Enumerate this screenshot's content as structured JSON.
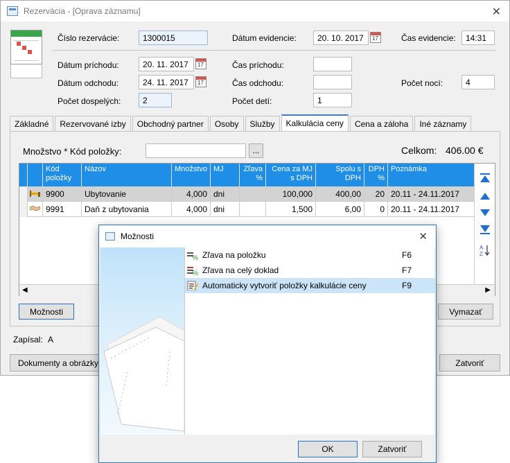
{
  "window": {
    "title": "Rezervácia - [Oprava záznamu]"
  },
  "header": {
    "cislo_label": "Číslo rezervácie:",
    "cislo_value": "1300015",
    "datum_ev_label": "Dátum evidencie:",
    "datum_ev_value": "20. 10. 2017",
    "cas_ev_label": "Čas evidencie:",
    "cas_ev_value": "14:31",
    "prichod_label": "Dátum príchodu:",
    "prichod_value": "20. 11. 2017",
    "cas_prichodu_label": "Čas príchodu:",
    "cas_prichodu_value": "",
    "odchod_label": "Dátum odchodu:",
    "odchod_value": "24. 11. 2017",
    "cas_odchodu_label": "Čas odchodu:",
    "cas_odchodu_value": "",
    "noci_label": "Počet nocí:",
    "noci_value": "4",
    "dospeli_label": "Počet dospelých:",
    "dospeli_value": "2",
    "deti_label": "Počet detí:",
    "deti_value": "1",
    "cal_glyph": "17"
  },
  "tabs": [
    "Základné",
    "Rezervované izby",
    "Obchodný partner",
    "Osoby",
    "Služby",
    "Kalkulácia ceny",
    "Cena a záloha",
    "Iné záznamy"
  ],
  "active_tab": "Kalkulácia ceny",
  "calc": {
    "qty_label": "Množstvo * Kód položky:",
    "qty_value": "",
    "browse_label": "...",
    "total_label": "Celkom:",
    "total_value": "406.00 €"
  },
  "table": {
    "headers": [
      "Kód položky",
      "Názov",
      "Množstvo",
      "MJ",
      "Zľava %",
      "Cena za MJ s DPH",
      "Spolu s DPH",
      "DPH %",
      "Poznámka"
    ],
    "rows": [
      {
        "icon": "bed-icon",
        "kod": "9900",
        "nazov": "Ubytovanie",
        "mnozstvo": "4,000",
        "mj": "dni",
        "zlava": "",
        "cena": "100,000",
        "spolu": "400,00",
        "dph": "20",
        "pozn": "20.11 - 24.11.2017"
      },
      {
        "icon": "handshake-icon",
        "kod": "9991",
        "nazov": "Daň z ubytovania",
        "mnozstvo": "4,000",
        "mj": "dni",
        "zlava": "",
        "cena": "1,500",
        "spolu": "6,00",
        "dph": "0",
        "pozn": "20.11 - 24.11.2017"
      }
    ]
  },
  "buttons": {
    "moznosti": "Možnosti",
    "vymazat": "Vymazať",
    "dokumenty": "Dokumenty a obrázky",
    "zatvorit": "Zatvoriť"
  },
  "footer": {
    "zapisal_label": "Zapísal:",
    "zapisal_value": "A"
  },
  "dialog": {
    "title": "Možnosti",
    "items": [
      {
        "label": "Zľava na položku",
        "key": "F6"
      },
      {
        "label": "Zľava na celý doklad",
        "key": "F7"
      },
      {
        "label": "Automaticky vytvoriť položky kalkulácie ceny",
        "key": "F9"
      }
    ],
    "ok": "OK",
    "zatvorit": "Zatvoriť"
  },
  "colors": {
    "accent": "#1f8ee6",
    "selection": "#cce4f7",
    "row_selected": "#d3d3d3"
  }
}
